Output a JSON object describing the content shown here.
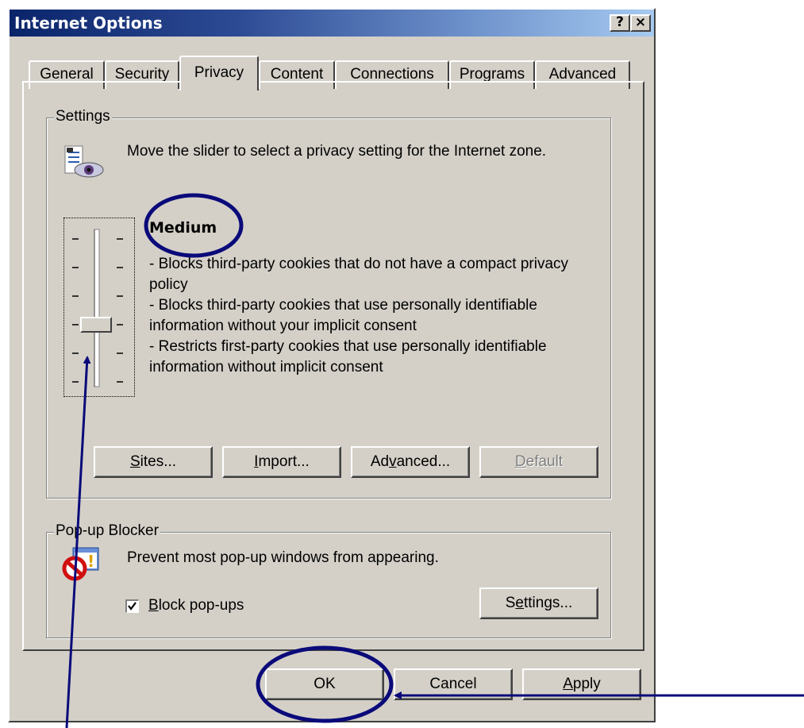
{
  "window": {
    "title": "Internet Options",
    "help_glyph": "?",
    "close_glyph": "×"
  },
  "tabs": [
    {
      "label": "General"
    },
    {
      "label": "Security"
    },
    {
      "label": "Privacy"
    },
    {
      "label": "Content"
    },
    {
      "label": "Connections"
    },
    {
      "label": "Programs"
    },
    {
      "label": "Advanced"
    }
  ],
  "active_tab": "Privacy",
  "settings": {
    "legend": "Settings",
    "icon": "privacy-eye-icon",
    "intro": "Move the slider to select a privacy setting for the Internet zone.",
    "level_name": "Medium",
    "description": [
      "- Blocks third-party cookies that do not have a compact privacy policy",
      "- Blocks third-party cookies that use personally identifiable information without your implicit consent",
      "- Restricts first-party cookies that use personally identifiable information without implicit consent"
    ],
    "slider_positions": 6,
    "slider_selected_index_from_top": 3,
    "buttons": {
      "sites": {
        "pre": "",
        "key": "S",
        "post": "ites..."
      },
      "import": {
        "pre": "",
        "key": "I",
        "post": "mport..."
      },
      "advanced": {
        "pre": "Ad",
        "key": "v",
        "post": "anced..."
      },
      "default": {
        "pre": "",
        "key": "D",
        "post": "efault",
        "disabled": true
      }
    }
  },
  "popup": {
    "legend": "Pop-up Blocker",
    "icon": "popup-blocker-icon",
    "text": "Prevent most pop-up windows from appearing.",
    "checkbox": {
      "checked": true,
      "pre": "",
      "key": "B",
      "post": "lock pop-ups"
    },
    "settings_button": {
      "pre": "S",
      "key": "e",
      "post": "ttings..."
    }
  },
  "footer": {
    "ok": "OK",
    "cancel": {
      "pre": "",
      "key": "",
      "post": "Cancel"
    },
    "apply": {
      "pre": "",
      "key": "A",
      "post": "pply"
    }
  },
  "colors": {
    "annotation": "#0a0a7a",
    "dialog_face": "#d4d0c8"
  }
}
